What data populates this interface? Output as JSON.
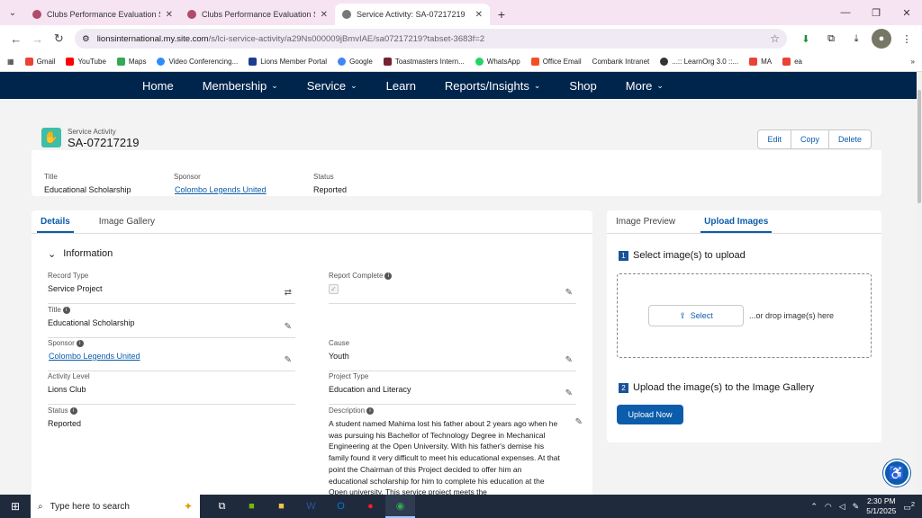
{
  "browser": {
    "tabs": [
      {
        "title": "Clubs Performance Evaluation S",
        "active": false
      },
      {
        "title": "Clubs Performance Evaluation S",
        "active": false
      },
      {
        "title": "Service Activity: SA-07217219",
        "active": true
      }
    ],
    "url_host": "lionsinternational.my.site.com",
    "url_path": "/s/lci-service-activity/a29Ns000009jBmvIAE/sa07217219?tabset-3683f=2",
    "bookmarks": [
      "Gmail",
      "YouTube",
      "Maps",
      "Video Conferencing...",
      "Lions Member Portal",
      "Google",
      "Toastmasters Intern...",
      "WhatsApp",
      "Office Email",
      "Combank Intranet",
      "...:: LearnOrg 3.0 ::...",
      "MA",
      "ea"
    ]
  },
  "nav": {
    "items": [
      {
        "label": "Home",
        "dropdown": false
      },
      {
        "label": "Membership",
        "dropdown": true
      },
      {
        "label": "Service",
        "dropdown": true
      },
      {
        "label": "Learn",
        "dropdown": false
      },
      {
        "label": "Reports/Insights",
        "dropdown": true
      },
      {
        "label": "Shop",
        "dropdown": false
      },
      {
        "label": "More",
        "dropdown": true
      }
    ]
  },
  "record": {
    "object_label": "Service Activity",
    "name": "SA-07217219",
    "actions": {
      "edit": "Edit",
      "copy": "Copy",
      "delete": "Delete"
    },
    "highlights": {
      "title_label": "Title",
      "title_value": "Educational Scholarship",
      "sponsor_label": "Sponsor",
      "sponsor_value": "Colombo Legends United",
      "status_label": "Status",
      "status_value": "Reported"
    }
  },
  "left_tabs": {
    "details": "Details",
    "gallery": "Image Gallery"
  },
  "section": {
    "title": "Information"
  },
  "fields": {
    "record_type": {
      "label": "Record Type",
      "value": "Service Project"
    },
    "report_complete": {
      "label": "Report Complete",
      "checked": true
    },
    "title": {
      "label": "Title",
      "value": "Educational Scholarship"
    },
    "sponsor": {
      "label": "Sponsor",
      "value": "Colombo Legends United"
    },
    "cause": {
      "label": "Cause",
      "value": "Youth"
    },
    "activity_level": {
      "label": "Activity Level",
      "value": "Lions Club"
    },
    "project_type": {
      "label": "Project Type",
      "value": "Education and Literacy"
    },
    "status": {
      "label": "Status",
      "value": "Reported"
    },
    "description": {
      "label": "Description",
      "value": "A student named Mahima lost his father about 2 years ago when he was pursuing his Bachellor of Technology Degree in Mechanical Engineering at the Open University. With his father's demise his family found it very difficult to meet his educational expenses. At that point the Chairman of this Project decided to offer him an educational scholarship for him to complete his education at the Open university. This service project meets the"
    }
  },
  "upload": {
    "tab_preview": "Image Preview",
    "tab_upload": "Upload Images",
    "step1_num": "1",
    "step1": "Select image(s) to upload",
    "select_btn": "Select",
    "drop_text": "...or drop image(s) here",
    "step2_num": "2",
    "step2": "Upload the image(s) to the Image Gallery",
    "upload_btn": "Upload Now"
  },
  "taskbar": {
    "search_placeholder": "Type here to search",
    "time": "2:30 PM",
    "date": "5/1/2025",
    "notifications": "2"
  },
  "colors": {
    "nav_bg": "#00254d",
    "link": "#0b5cab",
    "record_icon": "#3ebea8"
  }
}
